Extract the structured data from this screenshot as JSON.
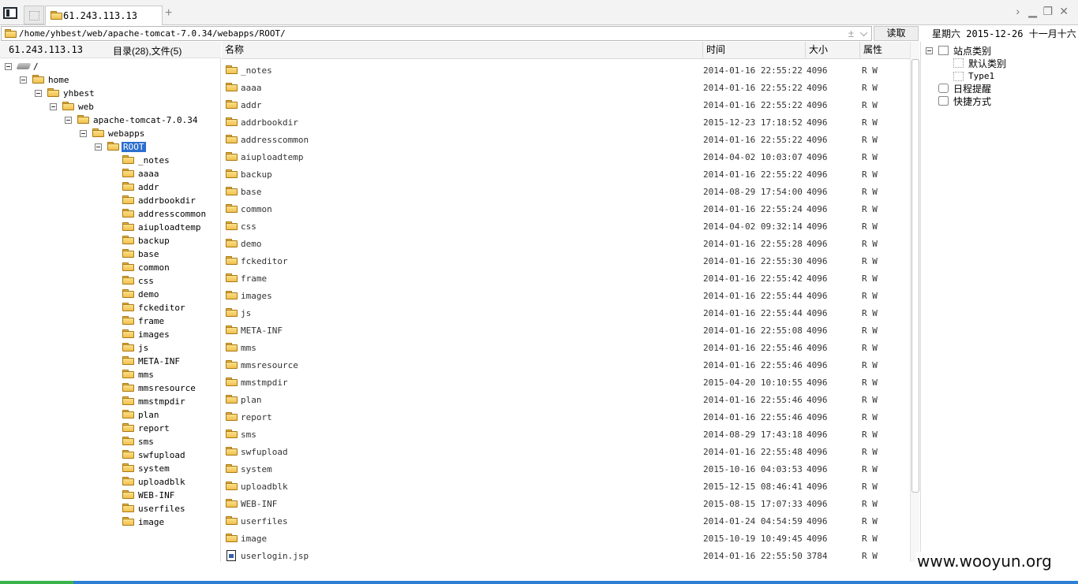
{
  "tab": {
    "title": "61.243.113.13",
    "add": "+"
  },
  "window_controls": {
    "forward": "›",
    "minimize": "▁",
    "restore": "❐",
    "close": "✕"
  },
  "address": {
    "path": "/home/yhbest/web/apache-tomcat-7.0.34/webapps/ROOT/",
    "plusminus": "±",
    "read_button": "读取"
  },
  "date": "星期六  2015-12-26  十一月十六",
  "left": {
    "host": "61.243.113.13",
    "counts": "目录(28),文件(5)"
  },
  "tree": [
    {
      "label": "/",
      "level": 0,
      "type": "drive"
    },
    {
      "label": "home",
      "level": 1,
      "type": "folder"
    },
    {
      "label": "yhbest",
      "level": 2,
      "type": "folder"
    },
    {
      "label": "web",
      "level": 3,
      "type": "folder"
    },
    {
      "label": "apache-tomcat-7.0.34",
      "level": 4,
      "type": "folder"
    },
    {
      "label": "webapps",
      "level": 5,
      "type": "folder"
    },
    {
      "label": "ROOT",
      "level": 6,
      "type": "folder",
      "selected": true
    },
    {
      "label": "_notes",
      "level": 7,
      "type": "folder"
    },
    {
      "label": "aaaa",
      "level": 7,
      "type": "folder"
    },
    {
      "label": "addr",
      "level": 7,
      "type": "folder"
    },
    {
      "label": "addrbookdir",
      "level": 7,
      "type": "folder"
    },
    {
      "label": "addresscommon",
      "level": 7,
      "type": "folder"
    },
    {
      "label": "aiuploadtemp",
      "level": 7,
      "type": "folder"
    },
    {
      "label": "backup",
      "level": 7,
      "type": "folder"
    },
    {
      "label": "base",
      "level": 7,
      "type": "folder"
    },
    {
      "label": "common",
      "level": 7,
      "type": "folder"
    },
    {
      "label": "css",
      "level": 7,
      "type": "folder"
    },
    {
      "label": "demo",
      "level": 7,
      "type": "folder"
    },
    {
      "label": "fckeditor",
      "level": 7,
      "type": "folder"
    },
    {
      "label": "frame",
      "level": 7,
      "type": "folder"
    },
    {
      "label": "images",
      "level": 7,
      "type": "folder"
    },
    {
      "label": "js",
      "level": 7,
      "type": "folder"
    },
    {
      "label": "META-INF",
      "level": 7,
      "type": "folder"
    },
    {
      "label": "mms",
      "level": 7,
      "type": "folder"
    },
    {
      "label": "mmsresource",
      "level": 7,
      "type": "folder"
    },
    {
      "label": "mmstmpdir",
      "level": 7,
      "type": "folder"
    },
    {
      "label": "plan",
      "level": 7,
      "type": "folder"
    },
    {
      "label": "report",
      "level": 7,
      "type": "folder"
    },
    {
      "label": "sms",
      "level": 7,
      "type": "folder"
    },
    {
      "label": "swfupload",
      "level": 7,
      "type": "folder"
    },
    {
      "label": "system",
      "level": 7,
      "type": "folder"
    },
    {
      "label": "uploadblk",
      "level": 7,
      "type": "folder"
    },
    {
      "label": "WEB-INF",
      "level": 7,
      "type": "folder"
    },
    {
      "label": "userfiles",
      "level": 7,
      "type": "folder"
    },
    {
      "label": "image",
      "level": 7,
      "type": "folder"
    }
  ],
  "columns": {
    "name": "名称",
    "time": "时间",
    "size": "大小",
    "attr": "属性"
  },
  "files": [
    {
      "name": "_notes",
      "time": "2014-01-16 22:55:22",
      "size": "4096",
      "attr": "R W",
      "type": "folder"
    },
    {
      "name": "aaaa",
      "time": "2014-01-16 22:55:22",
      "size": "4096",
      "attr": "R W",
      "type": "folder"
    },
    {
      "name": "addr",
      "time": "2014-01-16 22:55:22",
      "size": "4096",
      "attr": "R W",
      "type": "folder"
    },
    {
      "name": "addrbookdir",
      "time": "2015-12-23 17:18:52",
      "size": "4096",
      "attr": "R W",
      "type": "folder"
    },
    {
      "name": "addresscommon",
      "time": "2014-01-16 22:55:22",
      "size": "4096",
      "attr": "R W",
      "type": "folder"
    },
    {
      "name": "aiuploadtemp",
      "time": "2014-04-02 10:03:07",
      "size": "4096",
      "attr": "R W",
      "type": "folder"
    },
    {
      "name": "backup",
      "time": "2014-01-16 22:55:22",
      "size": "4096",
      "attr": "R W",
      "type": "folder"
    },
    {
      "name": "base",
      "time": "2014-08-29 17:54:00",
      "size": "4096",
      "attr": "R W",
      "type": "folder"
    },
    {
      "name": "common",
      "time": "2014-01-16 22:55:24",
      "size": "4096",
      "attr": "R W",
      "type": "folder"
    },
    {
      "name": "css",
      "time": "2014-04-02 09:32:14",
      "size": "4096",
      "attr": "R W",
      "type": "folder"
    },
    {
      "name": "demo",
      "time": "2014-01-16 22:55:28",
      "size": "4096",
      "attr": "R W",
      "type": "folder"
    },
    {
      "name": "fckeditor",
      "time": "2014-01-16 22:55:30",
      "size": "4096",
      "attr": "R W",
      "type": "folder"
    },
    {
      "name": "frame",
      "time": "2014-01-16 22:55:42",
      "size": "4096",
      "attr": "R W",
      "type": "folder"
    },
    {
      "name": "images",
      "time": "2014-01-16 22:55:44",
      "size": "4096",
      "attr": "R W",
      "type": "folder"
    },
    {
      "name": "js",
      "time": "2014-01-16 22:55:44",
      "size": "4096",
      "attr": "R W",
      "type": "folder"
    },
    {
      "name": "META-INF",
      "time": "2014-01-16 22:55:08",
      "size": "4096",
      "attr": "R W",
      "type": "folder"
    },
    {
      "name": "mms",
      "time": "2014-01-16 22:55:46",
      "size": "4096",
      "attr": "R W",
      "type": "folder"
    },
    {
      "name": "mmsresource",
      "time": "2014-01-16 22:55:46",
      "size": "4096",
      "attr": "R W",
      "type": "folder"
    },
    {
      "name": "mmstmpdir",
      "time": "2015-04-20 10:10:55",
      "size": "4096",
      "attr": "R W",
      "type": "folder"
    },
    {
      "name": "plan",
      "time": "2014-01-16 22:55:46",
      "size": "4096",
      "attr": "R W",
      "type": "folder"
    },
    {
      "name": "report",
      "time": "2014-01-16 22:55:46",
      "size": "4096",
      "attr": "R W",
      "type": "folder"
    },
    {
      "name": "sms",
      "time": "2014-08-29 17:43:18",
      "size": "4096",
      "attr": "R W",
      "type": "folder"
    },
    {
      "name": "swfupload",
      "time": "2014-01-16 22:55:48",
      "size": "4096",
      "attr": "R W",
      "type": "folder"
    },
    {
      "name": "system",
      "time": "2015-10-16 04:03:53",
      "size": "4096",
      "attr": "R W",
      "type": "folder"
    },
    {
      "name": "uploadblk",
      "time": "2015-12-15 08:46:41",
      "size": "4096",
      "attr": "R W",
      "type": "folder"
    },
    {
      "name": "WEB-INF",
      "time": "2015-08-15 17:07:33",
      "size": "4096",
      "attr": "R W",
      "type": "folder"
    },
    {
      "name": "userfiles",
      "time": "2014-01-24 04:54:59",
      "size": "4096",
      "attr": "R W",
      "type": "folder"
    },
    {
      "name": "image",
      "time": "2015-10-19 10:49:45",
      "size": "4096",
      "attr": "R W",
      "type": "folder"
    },
    {
      "name": "userlogin.jsp",
      "time": "2014-01-16 22:55:50",
      "size": "3784",
      "attr": "R W",
      "type": "file"
    }
  ],
  "right_panel": {
    "site_category": "站点类别",
    "default_category": "默认类别",
    "type1": "Type1",
    "schedule": "日程提醒",
    "shortcuts": "快捷方式"
  },
  "watermark": "www.wooyun.org",
  "colors": {
    "selection": "#2b6fd0",
    "folder": "#f2c14e",
    "taskbar": "#2d7fd6",
    "taskbar_start": "#3ab44a"
  }
}
